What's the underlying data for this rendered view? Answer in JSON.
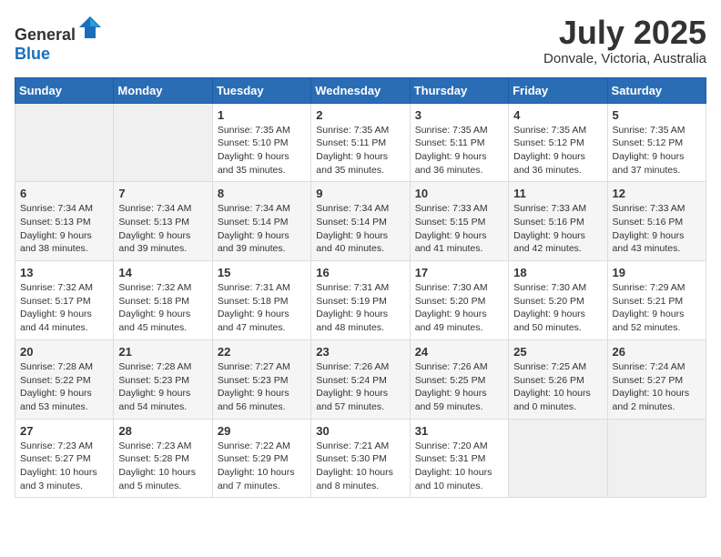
{
  "header": {
    "logo_general": "General",
    "logo_blue": "Blue",
    "month_year": "July 2025",
    "location": "Donvale, Victoria, Australia"
  },
  "calendar": {
    "days_of_week": [
      "Sunday",
      "Monday",
      "Tuesday",
      "Wednesday",
      "Thursday",
      "Friday",
      "Saturday"
    ],
    "weeks": [
      [
        {
          "day": "",
          "info": ""
        },
        {
          "day": "",
          "info": ""
        },
        {
          "day": "1",
          "info": "Sunrise: 7:35 AM\nSunset: 5:10 PM\nDaylight: 9 hours\nand 35 minutes."
        },
        {
          "day": "2",
          "info": "Sunrise: 7:35 AM\nSunset: 5:11 PM\nDaylight: 9 hours\nand 35 minutes."
        },
        {
          "day": "3",
          "info": "Sunrise: 7:35 AM\nSunset: 5:11 PM\nDaylight: 9 hours\nand 36 minutes."
        },
        {
          "day": "4",
          "info": "Sunrise: 7:35 AM\nSunset: 5:12 PM\nDaylight: 9 hours\nand 36 minutes."
        },
        {
          "day": "5",
          "info": "Sunrise: 7:35 AM\nSunset: 5:12 PM\nDaylight: 9 hours\nand 37 minutes."
        }
      ],
      [
        {
          "day": "6",
          "info": "Sunrise: 7:34 AM\nSunset: 5:13 PM\nDaylight: 9 hours\nand 38 minutes."
        },
        {
          "day": "7",
          "info": "Sunrise: 7:34 AM\nSunset: 5:13 PM\nDaylight: 9 hours\nand 39 minutes."
        },
        {
          "day": "8",
          "info": "Sunrise: 7:34 AM\nSunset: 5:14 PM\nDaylight: 9 hours\nand 39 minutes."
        },
        {
          "day": "9",
          "info": "Sunrise: 7:34 AM\nSunset: 5:14 PM\nDaylight: 9 hours\nand 40 minutes."
        },
        {
          "day": "10",
          "info": "Sunrise: 7:33 AM\nSunset: 5:15 PM\nDaylight: 9 hours\nand 41 minutes."
        },
        {
          "day": "11",
          "info": "Sunrise: 7:33 AM\nSunset: 5:16 PM\nDaylight: 9 hours\nand 42 minutes."
        },
        {
          "day": "12",
          "info": "Sunrise: 7:33 AM\nSunset: 5:16 PM\nDaylight: 9 hours\nand 43 minutes."
        }
      ],
      [
        {
          "day": "13",
          "info": "Sunrise: 7:32 AM\nSunset: 5:17 PM\nDaylight: 9 hours\nand 44 minutes."
        },
        {
          "day": "14",
          "info": "Sunrise: 7:32 AM\nSunset: 5:18 PM\nDaylight: 9 hours\nand 45 minutes."
        },
        {
          "day": "15",
          "info": "Sunrise: 7:31 AM\nSunset: 5:18 PM\nDaylight: 9 hours\nand 47 minutes."
        },
        {
          "day": "16",
          "info": "Sunrise: 7:31 AM\nSunset: 5:19 PM\nDaylight: 9 hours\nand 48 minutes."
        },
        {
          "day": "17",
          "info": "Sunrise: 7:30 AM\nSunset: 5:20 PM\nDaylight: 9 hours\nand 49 minutes."
        },
        {
          "day": "18",
          "info": "Sunrise: 7:30 AM\nSunset: 5:20 PM\nDaylight: 9 hours\nand 50 minutes."
        },
        {
          "day": "19",
          "info": "Sunrise: 7:29 AM\nSunset: 5:21 PM\nDaylight: 9 hours\nand 52 minutes."
        }
      ],
      [
        {
          "day": "20",
          "info": "Sunrise: 7:28 AM\nSunset: 5:22 PM\nDaylight: 9 hours\nand 53 minutes."
        },
        {
          "day": "21",
          "info": "Sunrise: 7:28 AM\nSunset: 5:23 PM\nDaylight: 9 hours\nand 54 minutes."
        },
        {
          "day": "22",
          "info": "Sunrise: 7:27 AM\nSunset: 5:23 PM\nDaylight: 9 hours\nand 56 minutes."
        },
        {
          "day": "23",
          "info": "Sunrise: 7:26 AM\nSunset: 5:24 PM\nDaylight: 9 hours\nand 57 minutes."
        },
        {
          "day": "24",
          "info": "Sunrise: 7:26 AM\nSunset: 5:25 PM\nDaylight: 9 hours\nand 59 minutes."
        },
        {
          "day": "25",
          "info": "Sunrise: 7:25 AM\nSunset: 5:26 PM\nDaylight: 10 hours\nand 0 minutes."
        },
        {
          "day": "26",
          "info": "Sunrise: 7:24 AM\nSunset: 5:27 PM\nDaylight: 10 hours\nand 2 minutes."
        }
      ],
      [
        {
          "day": "27",
          "info": "Sunrise: 7:23 AM\nSunset: 5:27 PM\nDaylight: 10 hours\nand 3 minutes."
        },
        {
          "day": "28",
          "info": "Sunrise: 7:23 AM\nSunset: 5:28 PM\nDaylight: 10 hours\nand 5 minutes."
        },
        {
          "day": "29",
          "info": "Sunrise: 7:22 AM\nSunset: 5:29 PM\nDaylight: 10 hours\nand 7 minutes."
        },
        {
          "day": "30",
          "info": "Sunrise: 7:21 AM\nSunset: 5:30 PM\nDaylight: 10 hours\nand 8 minutes."
        },
        {
          "day": "31",
          "info": "Sunrise: 7:20 AM\nSunset: 5:31 PM\nDaylight: 10 hours\nand 10 minutes."
        },
        {
          "day": "",
          "info": ""
        },
        {
          "day": "",
          "info": ""
        }
      ]
    ]
  }
}
